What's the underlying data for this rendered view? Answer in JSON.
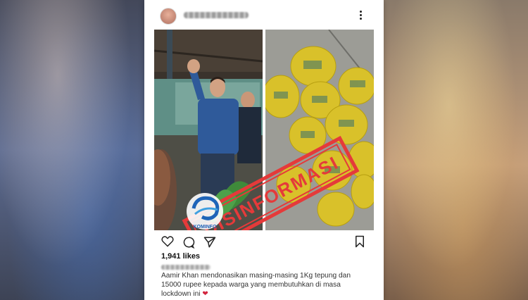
{
  "post": {
    "likes": "1,941 likes",
    "caption": "Aamir Khan mendonasikan masing-masing 1Kg tepung dan 15000 rupee kepada warga yang membutuhkan di masa lockdown ini",
    "caption_emoji": "❤",
    "stamp_text": "DISINFORMASI",
    "logo_text": "KOMINFO"
  },
  "colors": {
    "stamp": "#e53a3a",
    "heart_emoji": "#d2243e"
  },
  "icons": [
    "heart-icon",
    "comment-icon",
    "share-icon",
    "bookmark-icon",
    "more-options-icon"
  ]
}
